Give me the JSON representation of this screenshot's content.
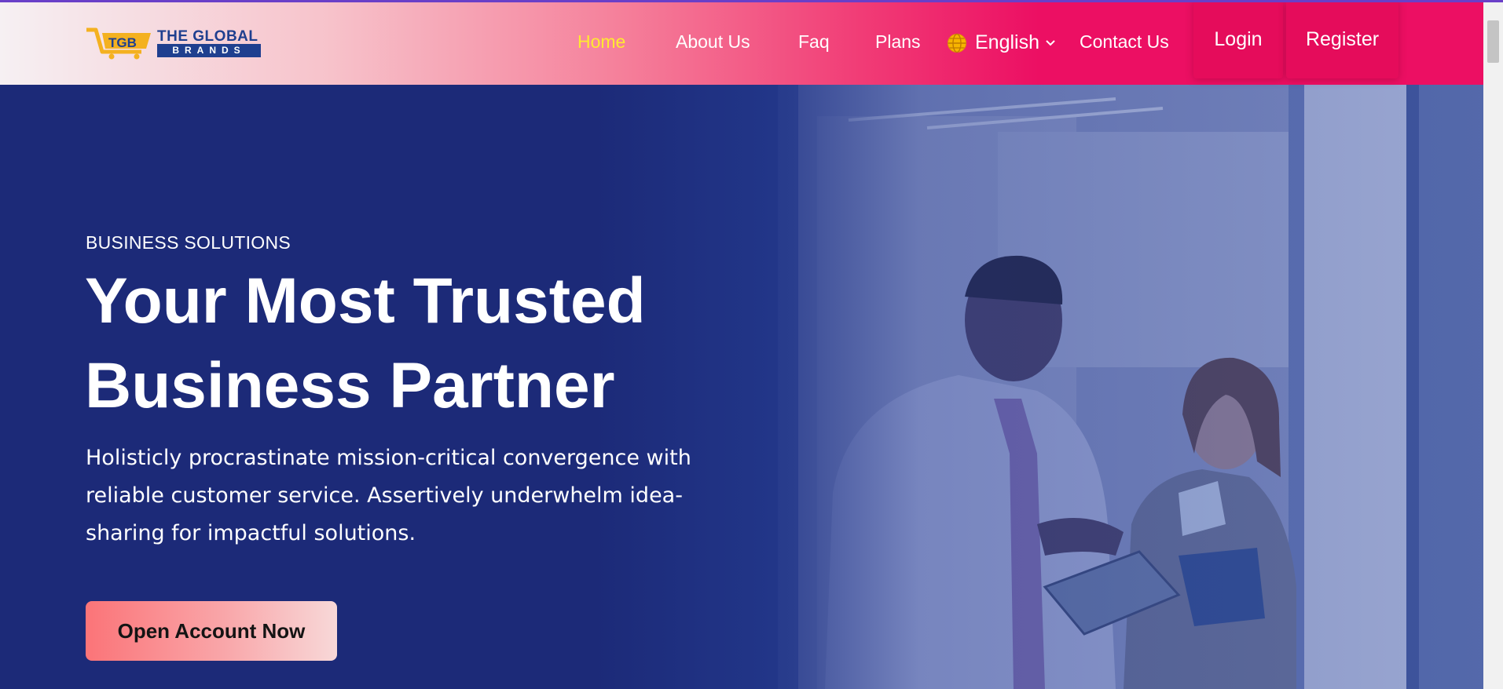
{
  "brand": {
    "logo_mark": "TGB",
    "name_top": "THE GLOBAL",
    "name_bottom": "BRANDS"
  },
  "nav": {
    "items": [
      {
        "label": "Home",
        "active": true
      },
      {
        "label": "About Us",
        "active": false
      },
      {
        "label": "Faq",
        "active": false
      },
      {
        "label": "Plans",
        "active": false
      }
    ],
    "language": {
      "label": "English",
      "icon": "globe-icon"
    },
    "contact": "Contact Us",
    "login": "Login",
    "register": "Register"
  },
  "hero": {
    "eyebrow": "BUSINESS SOLUTIONS",
    "headline_line1": "Your Most Trusted",
    "headline_line2": "Business Partner",
    "lead": "Holisticly procrastinate mission-critical convergence with reliable customer service. Assertively underwhelm idea-sharing for impactful solutions.",
    "cta": "Open Account Now"
  },
  "colors": {
    "header_pink": "#ec0f63",
    "hero_navy": "#1c2a78",
    "active_nav": "#ffe930",
    "cta_coral": "#fb7478"
  }
}
